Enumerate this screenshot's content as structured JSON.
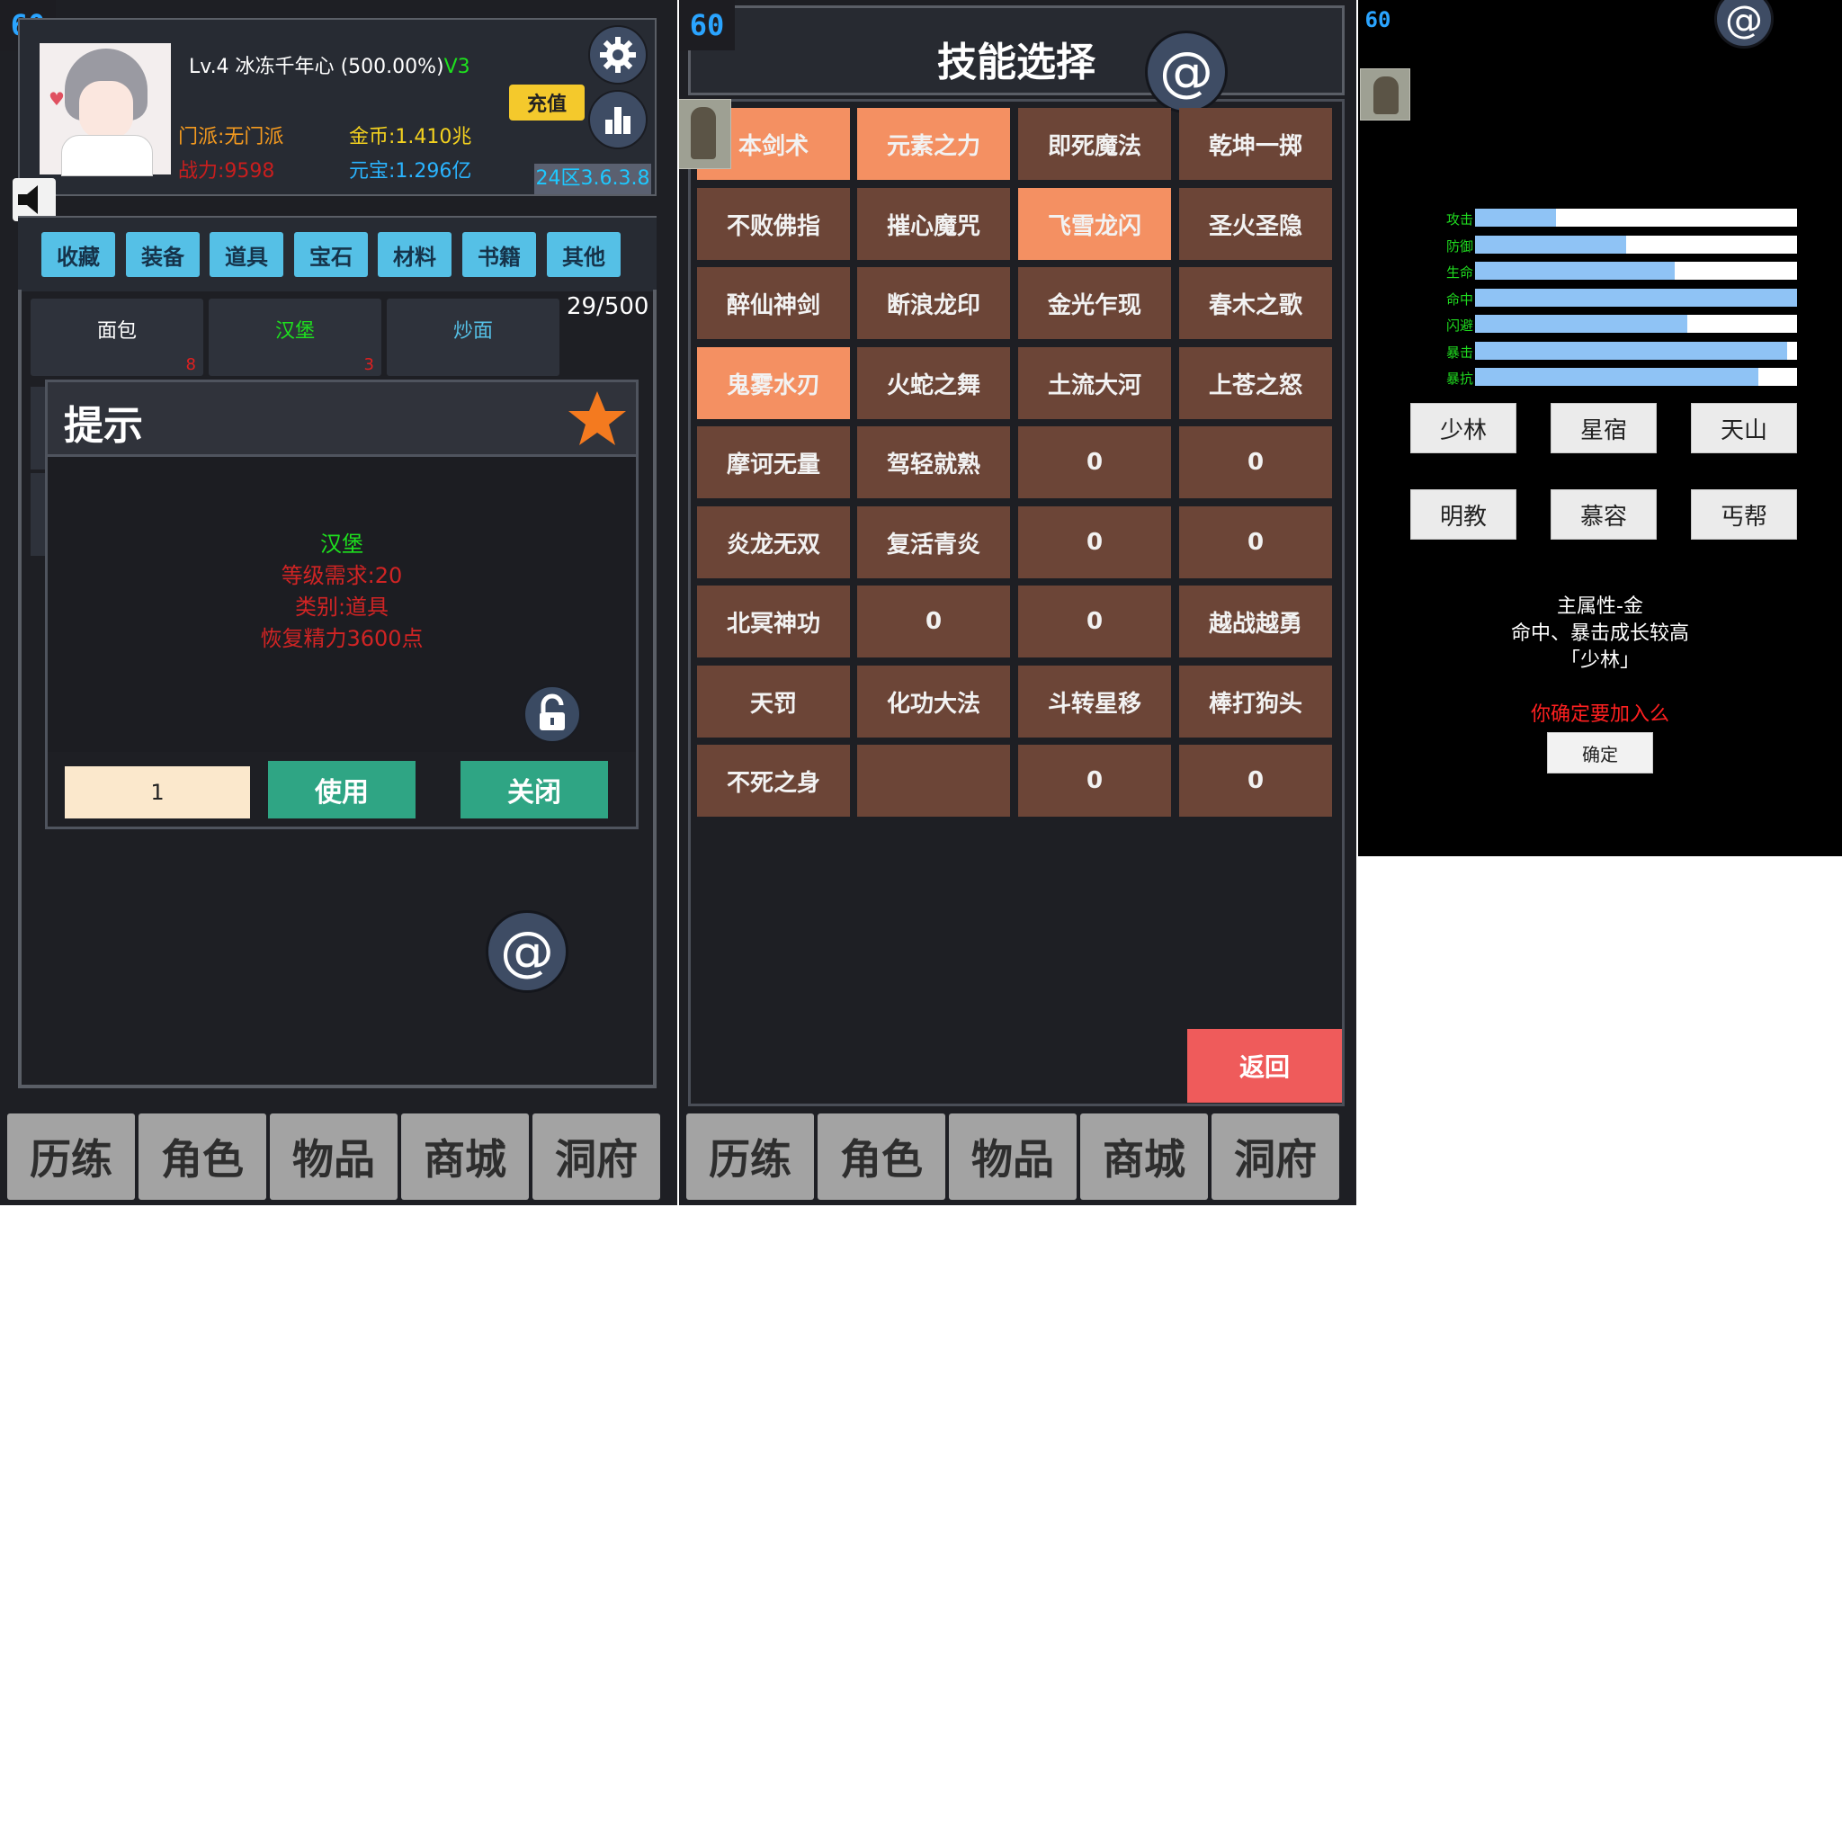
{
  "panel1": {
    "fps": "60",
    "player": {
      "level_name": "Lv.4 冰冻千年心",
      "exp": "(500.00%)",
      "vip": "V3",
      "sect": "门派:无门派",
      "power": "战力:9598",
      "gold": "金币:1.410兆",
      "ingot": "元宝:1.296亿"
    },
    "recharge_label": "充值",
    "version": "24区3.6.3.8",
    "categories": [
      "收藏",
      "装备",
      "道具",
      "宝石",
      "材料",
      "书籍",
      "其他"
    ],
    "inventory_count": "29/500",
    "items": [
      {
        "name": "面包",
        "count": "8",
        "color": "#ffffff"
      },
      {
        "name": "汉堡",
        "count": "3",
        "color": "#1ee01e"
      },
      {
        "name": "炒面",
        "count": "",
        "color": "#55c0e6"
      }
    ],
    "dialog": {
      "title": "提示",
      "item_name": "汉堡",
      "level_req": "等级需求:20",
      "category": "类别:道具",
      "effect": "恢复精力3600点",
      "quantity": "1",
      "use_label": "使用",
      "close_label": "关闭"
    },
    "at_icon": "@",
    "colors": {
      "accent_blue": "#55c0e6",
      "green": "#2fa584",
      "danger": "#e02020"
    }
  },
  "panel2": {
    "fps": "60",
    "title": "技能选择",
    "at_icon": "@",
    "skills": [
      {
        "label": "本剑术",
        "selected": true
      },
      {
        "label": "元素之力",
        "selected": true
      },
      {
        "label": "即死魔法",
        "selected": false
      },
      {
        "label": "乾坤一掷",
        "selected": false
      },
      {
        "label": "不败佛指",
        "selected": false
      },
      {
        "label": "摧心魔咒",
        "selected": false
      },
      {
        "label": "飞雪龙闪",
        "selected": true
      },
      {
        "label": "圣火圣隐",
        "selected": false
      },
      {
        "label": "醉仙神剑",
        "selected": false
      },
      {
        "label": "断浪龙印",
        "selected": false
      },
      {
        "label": "金光乍现",
        "selected": false
      },
      {
        "label": "春木之歌",
        "selected": false
      },
      {
        "label": "鬼雾水刃",
        "selected": true
      },
      {
        "label": "火蛇之舞",
        "selected": false
      },
      {
        "label": "土流大河",
        "selected": false
      },
      {
        "label": "上苍之怒",
        "selected": false
      },
      {
        "label": "摩诃无量",
        "selected": false
      },
      {
        "label": "驾轻就熟",
        "selected": false
      },
      {
        "label": "0",
        "selected": false
      },
      {
        "label": "0",
        "selected": false
      },
      {
        "label": "炎龙无双",
        "selected": false
      },
      {
        "label": "复活青炎",
        "selected": false
      },
      {
        "label": "0",
        "selected": false
      },
      {
        "label": "0",
        "selected": false
      },
      {
        "label": "北冥神功",
        "selected": false
      },
      {
        "label": "0",
        "selected": false
      },
      {
        "label": "0",
        "selected": false
      },
      {
        "label": "越战越勇",
        "selected": false
      },
      {
        "label": "天罚",
        "selected": false
      },
      {
        "label": "化功大法",
        "selected": false
      },
      {
        "label": "斗转星移",
        "selected": false
      },
      {
        "label": "棒打狗头",
        "selected": false
      },
      {
        "label": "不死之身",
        "selected": false
      },
      {
        "label": "",
        "selected": false
      },
      {
        "label": "0",
        "selected": false
      },
      {
        "label": "0",
        "selected": false
      }
    ],
    "back_label": "返回",
    "colors": {
      "selected": "#f49062",
      "normal": "#6c4537",
      "back": "#ef5b5b"
    }
  },
  "nav": [
    "历练",
    "角色",
    "物品",
    "商城",
    "洞府"
  ],
  "panel3": {
    "fps": "60",
    "at_icon": "@",
    "stats": [
      {
        "label": "攻击",
        "fill": 0.25
      },
      {
        "label": "防御",
        "fill": 0.47
      },
      {
        "label": "生命",
        "fill": 0.62
      },
      {
        "label": "命中",
        "fill": 1.0
      },
      {
        "label": "闪避",
        "fill": 0.66
      },
      {
        "label": "暴击",
        "fill": 0.97
      },
      {
        "label": "暴抗",
        "fill": 0.88
      }
    ],
    "sects": [
      "少林",
      "星宿",
      "天山",
      "明教",
      "慕容",
      "丐帮"
    ],
    "attr_line": "主属性-金",
    "growth_line": "命中、暴击成长较高",
    "sect_name": "「少林」",
    "confirm_question": "你确定要加入么",
    "confirm_label": "确定",
    "colors": {
      "bar_fill": "#8fc3f5",
      "label": "#1fd91f",
      "question": "#ff2020"
    }
  }
}
